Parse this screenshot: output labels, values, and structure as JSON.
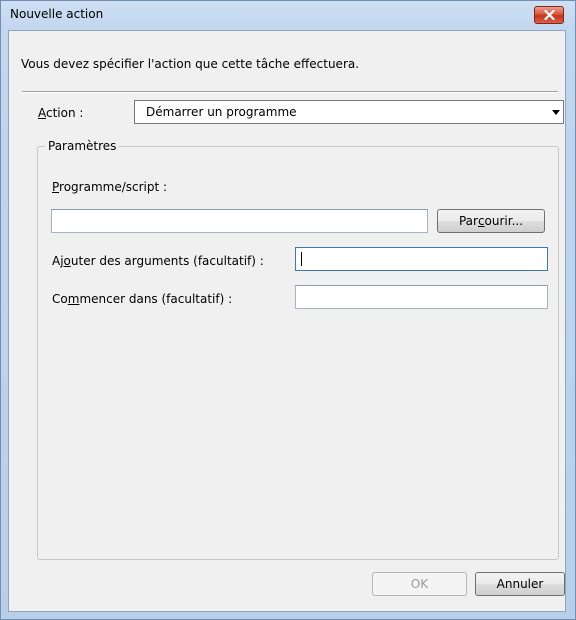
{
  "window": {
    "title": "Nouvelle action"
  },
  "instruction": "Vous devez spécifier l'action que cette tâche effectuera.",
  "action": {
    "label_mnemonic": "A",
    "label_rest": "ction :",
    "selected": "Démarrer un programme"
  },
  "group": {
    "title": "Paramètres",
    "program": {
      "label_mnemonic": "P",
      "label_rest": "rogramme/script :",
      "value": ""
    },
    "browse": {
      "pre": "Par",
      "mnemonic": "c",
      "post": "ourir..."
    },
    "arguments": {
      "label_pre": "Aj",
      "label_mnemonic": "o",
      "label_post": "uter des arguments (facultatif) :",
      "value": ""
    },
    "start_in": {
      "label_pre": "Co",
      "label_mnemonic": "m",
      "label_post": "mencer dans (facultatif) :",
      "value": ""
    }
  },
  "buttons": {
    "ok": "OK",
    "cancel": "Annuler"
  },
  "colors": {
    "title_bar": "#c2d6ee",
    "close_button": "#d9563b",
    "client": "#f0f0f0"
  }
}
